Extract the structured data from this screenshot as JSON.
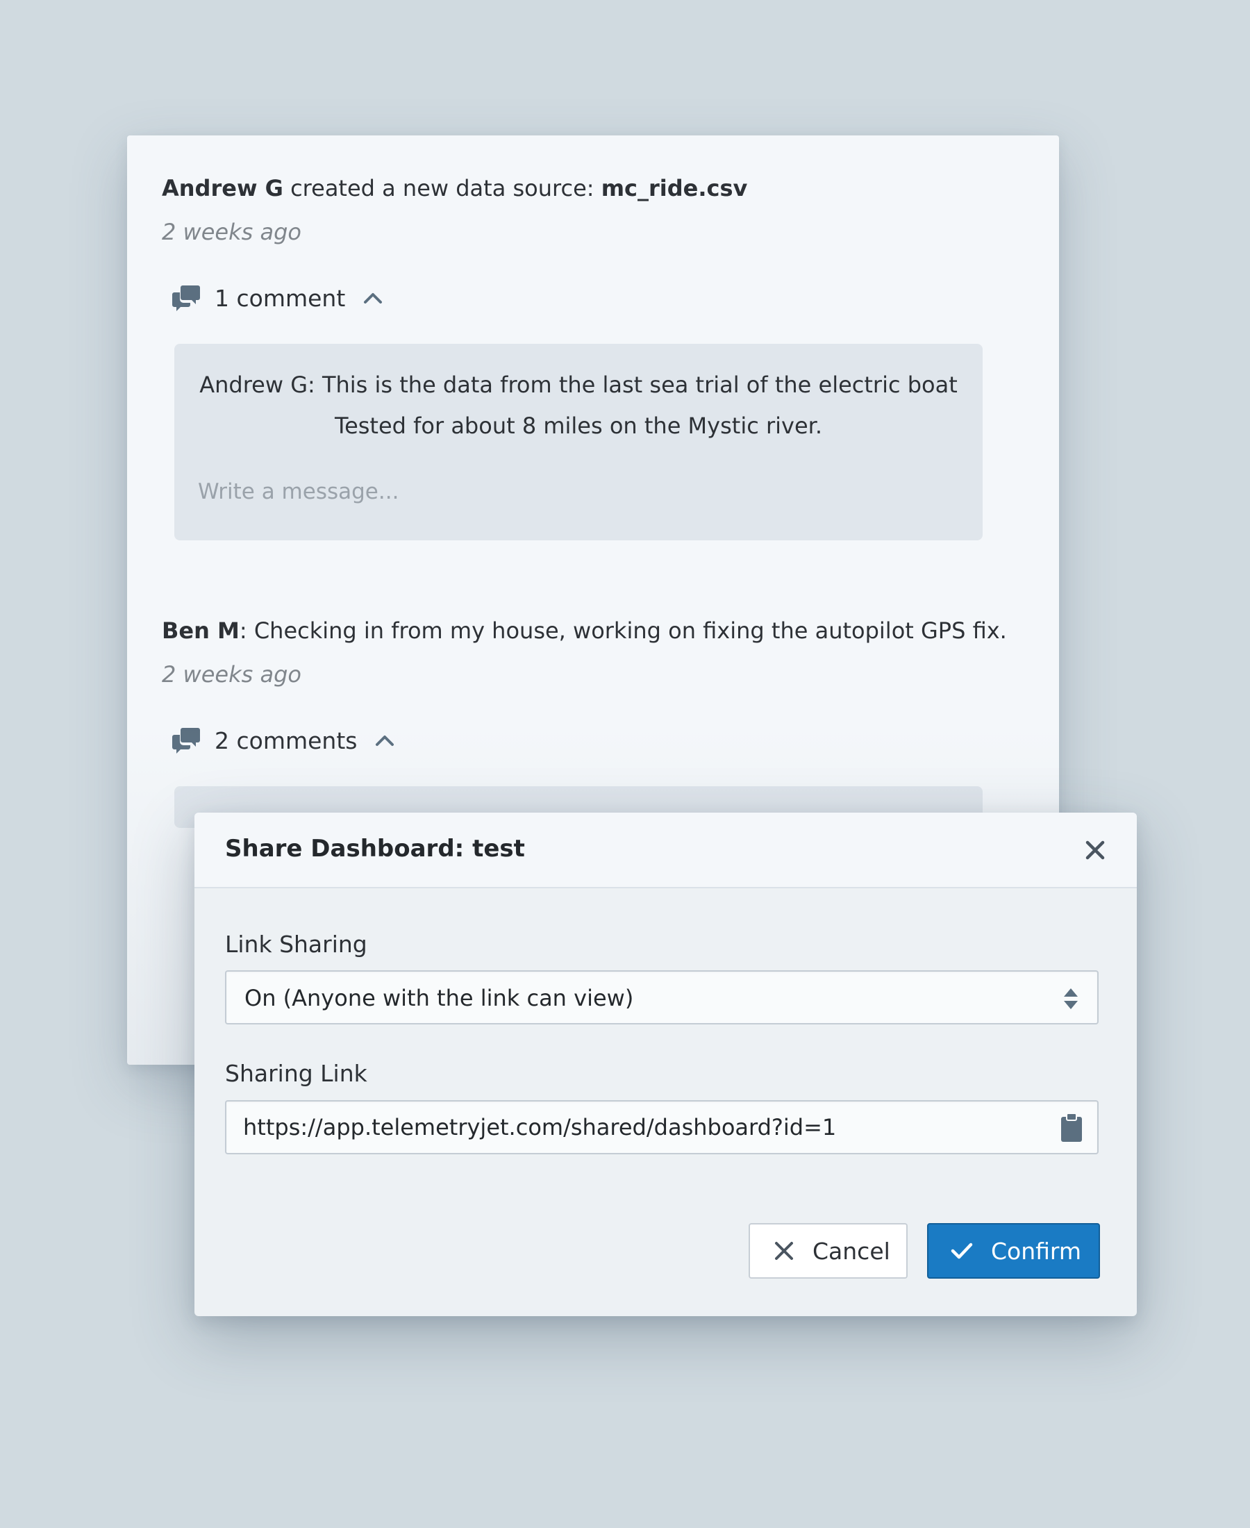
{
  "feed": {
    "entries": [
      {
        "author": "Andrew G",
        "action": " created a new data source: ",
        "target": "mc_ride.csv",
        "time": "2 weeks ago",
        "comment_count_label": "1 comment",
        "thread": {
          "message_line1": "Andrew G: This is the data from the last sea trial of the electric boat",
          "message_line2": "Tested for about 8 miles on the Mystic river.",
          "input_placeholder": "Write a message..."
        }
      },
      {
        "author": "Ben M",
        "action": ": Checking in from my house, working on fixing the autopilot GPS fix.",
        "time": "2 weeks ago",
        "comment_count_label": "2 comments"
      }
    ]
  },
  "dialog": {
    "title": "Share Dashboard: test",
    "link_sharing_label": "Link Sharing",
    "link_sharing_value": "On (Anyone with the link can view)",
    "sharing_link_label": "Sharing Link",
    "sharing_link_value": "https://app.telemetryjet.com/shared/dashboard?id=1",
    "cancel_label": "Cancel",
    "confirm_label": "Confirm"
  },
  "colors": {
    "background": "#d0dae0",
    "panel": "#f4f7fa",
    "thread": "#e0e6ec",
    "dialog_body": "#edf1f4",
    "primary": "#1a7bc4",
    "icon": "#5b6f80"
  },
  "icons": {
    "comments": "comment-bubbles-icon",
    "expand": "chevron-up-icon",
    "close": "close-icon",
    "select": "select-arrows-icon",
    "copy": "clipboard-icon",
    "cancel": "x-icon",
    "confirm": "check-icon"
  }
}
